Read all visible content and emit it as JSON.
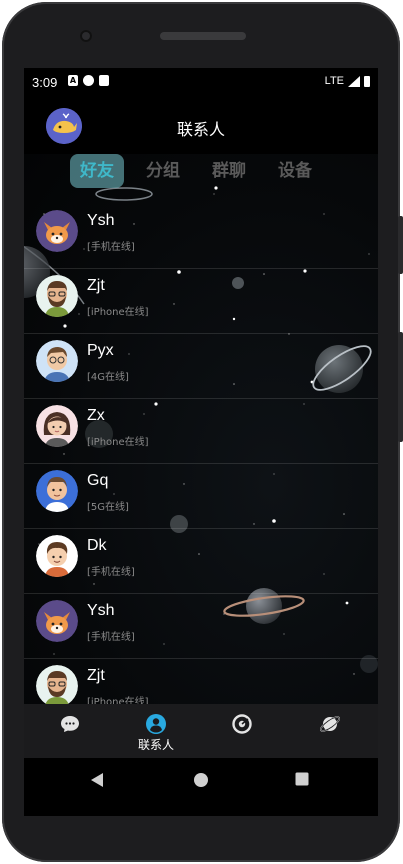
{
  "status_bar": {
    "time": "3:09",
    "network": "LTE"
  },
  "header": {
    "title": "联系人"
  },
  "tabs": [
    {
      "label": "好友",
      "active": true
    },
    {
      "label": "分组",
      "active": false
    },
    {
      "label": "群聊",
      "active": false
    },
    {
      "label": "设备",
      "active": false
    }
  ],
  "contacts": [
    {
      "name": "Ysh",
      "status": "[手机在线]",
      "avatar": "fox"
    },
    {
      "name": "Zjt",
      "status": "[iPhone在线]",
      "avatar": "man-beard"
    },
    {
      "name": "Pyx",
      "status": "[4G在线]",
      "avatar": "man-glasses"
    },
    {
      "name": "Zx",
      "status": "[iPhone在线]",
      "avatar": "woman"
    },
    {
      "name": "Gq",
      "status": "[5G在线]",
      "avatar": "man-blue"
    },
    {
      "name": "Dk",
      "status": "[手机在线]",
      "avatar": "boy"
    },
    {
      "name": "Ysh",
      "status": "[手机在线]",
      "avatar": "fox"
    },
    {
      "name": "Zjt",
      "status": "[iPhone在线]",
      "avatar": "man-beard"
    }
  ],
  "bottom_nav": [
    {
      "icon": "chat-bubble-icon",
      "label": "",
      "active": false
    },
    {
      "icon": "contacts-icon",
      "label": "联系人",
      "active": true
    },
    {
      "icon": "moments-icon",
      "label": "",
      "active": false
    },
    {
      "icon": "planet-icon",
      "label": "",
      "active": false
    }
  ],
  "colors": {
    "accent": "#3fb8c9",
    "nav_active": "#29a9e0",
    "background": "#000000"
  }
}
